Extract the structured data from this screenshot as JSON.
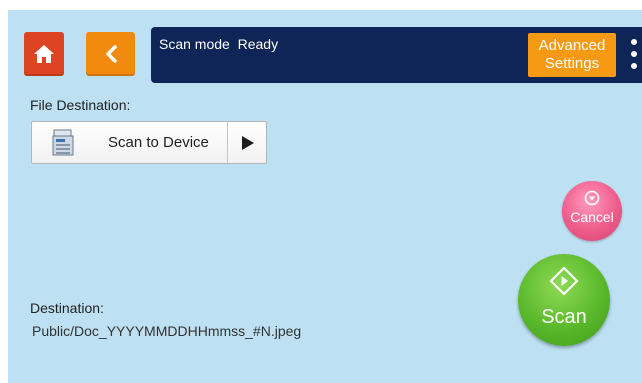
{
  "header": {
    "home_icon": "home-icon",
    "back_icon": "chevron-left-icon",
    "status": "Scan mode  Ready",
    "advanced_line1": "Advanced",
    "advanced_line2": "Settings",
    "more_icon": "more-vert-icon"
  },
  "file_destination": {
    "label": "File Destination:",
    "selected": "Scan to Device",
    "device_icon": "printer-device-icon",
    "arrow_icon": "play-arrow-icon"
  },
  "actions": {
    "cancel_label": "Cancel",
    "scan_label": "Scan"
  },
  "destination": {
    "label": "Destination:",
    "path": "Public/Doc_YYYYMMDDHHmmss_#N.jpeg"
  },
  "colors": {
    "background": "#bde0f2",
    "status_bar": "#0f2457",
    "home_button": "#dd4422",
    "accent_orange": "#f28a10",
    "cancel_pink": "#ef5c8c",
    "scan_green": "#5ab82b"
  }
}
